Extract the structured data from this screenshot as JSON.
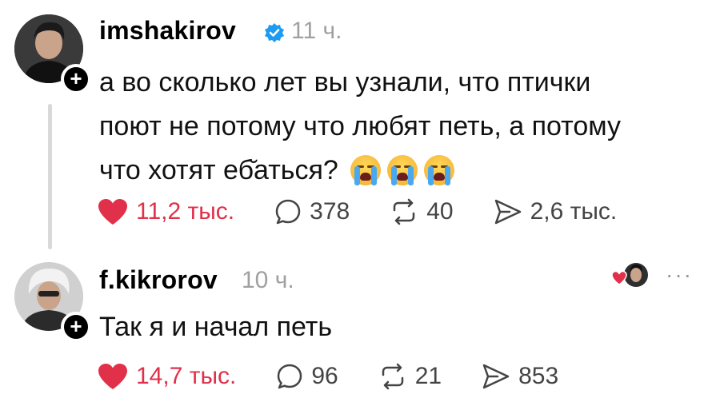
{
  "posts": [
    {
      "username": "imshakirov",
      "time": "11 ч.",
      "text_lines": [
        "а во сколько лет вы узнали, что птички",
        "поют не потому что любят петь, а потому",
        "что хотят еб̆аться?"
      ],
      "emojis": [
        "crying-face-emoji",
        "crying-face-emoji",
        "crying-face-emoji"
      ],
      "likes": "11,2 тыс.",
      "replies": "378",
      "reposts": "40",
      "shares": "2,6 тыс."
    },
    {
      "username": "f.kikrorov",
      "time": "10 ч.",
      "text": "Так я и начал петь",
      "likes": "14,7 тыс.",
      "replies": "96",
      "reposts": "21",
      "shares": "853",
      "more": "···"
    }
  ],
  "colors": {
    "like": "#e0304a",
    "verified": "#1d9bf0",
    "muted": "#a0a0a0",
    "thread_line": "#d9d9d9"
  }
}
